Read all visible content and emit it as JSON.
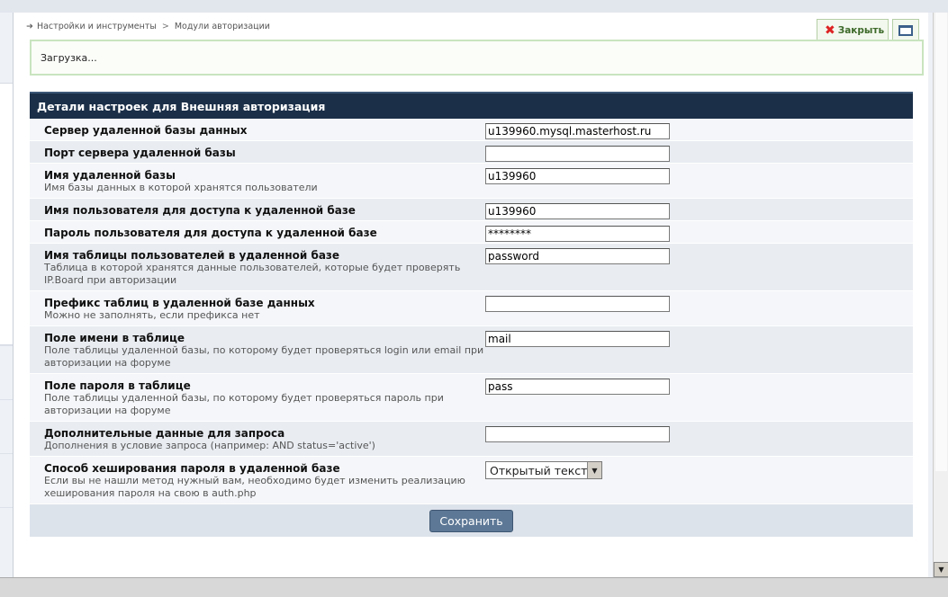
{
  "breadcrumb": {
    "items": [
      "Настройки и инструменты",
      "Модули авторизации"
    ],
    "separator": ">"
  },
  "tabs": {
    "close_label": "Закрыть"
  },
  "status": {
    "loading_text": "Загрузка..."
  },
  "panel": {
    "title": "Детали настроек для Внешняя авторизация",
    "rows": [
      {
        "label": "Сервер удаленной базы данных",
        "desc": "",
        "type": "text",
        "value": "u139960.mysql.masterhost.ru"
      },
      {
        "label": "Порт сервера удаленной базы",
        "desc": "",
        "type": "text",
        "value": ""
      },
      {
        "label": "Имя удаленной базы",
        "desc": "Имя базы данных в которой хранятся пользователи",
        "type": "text",
        "value": "u139960"
      },
      {
        "label": "Имя пользователя для доступа к удаленной базе",
        "desc": "",
        "type": "text",
        "value": "u139960"
      },
      {
        "label": "Пароль пользователя для доступа к удаленной базе",
        "desc": "",
        "type": "password",
        "value": "********"
      },
      {
        "label": "Имя таблицы пользователей в удаленной базе",
        "desc": "Таблица в которой хранятся данные пользователей, которые будет проверять IP.Board при авторизации",
        "type": "text",
        "value": "password"
      },
      {
        "label": "Префикс таблиц в удаленной базе данных",
        "desc": "Можно не заполнять, если префикса нет",
        "type": "text",
        "value": ""
      },
      {
        "label": "Поле имени в таблице",
        "desc": "Поле таблицы удаленной базы, по которому будет проверяться login или email при авторизации на форуме",
        "type": "text",
        "value": "mail"
      },
      {
        "label": "Поле пароля в таблице",
        "desc": "Поле таблицы удаленной базы, по которому будет проверяться пароль при авторизации на форуме",
        "type": "text",
        "value": "pass"
      },
      {
        "label": "Дополнительные данные для запроса",
        "desc": "Дополнения в условие запроса (например: AND status='active')",
        "type": "text",
        "value": ""
      },
      {
        "label": "Способ хеширования пароля в удаленной базе",
        "desc": "Если вы не нашли метод нужный вам, необходимо будет изменить реализацию хеширования пароля на свою в auth.php",
        "type": "select",
        "value": "Открытый текст"
      }
    ],
    "save_label": "Сохранить"
  },
  "icons": {
    "breadcrumb_arrow": "arrow-right-icon",
    "close": "close-x-icon",
    "window": "window-icon"
  },
  "colors": {
    "header_bg": "#1b2f48",
    "close_x": "#dd2222",
    "save_btn": "#5d7896"
  }
}
